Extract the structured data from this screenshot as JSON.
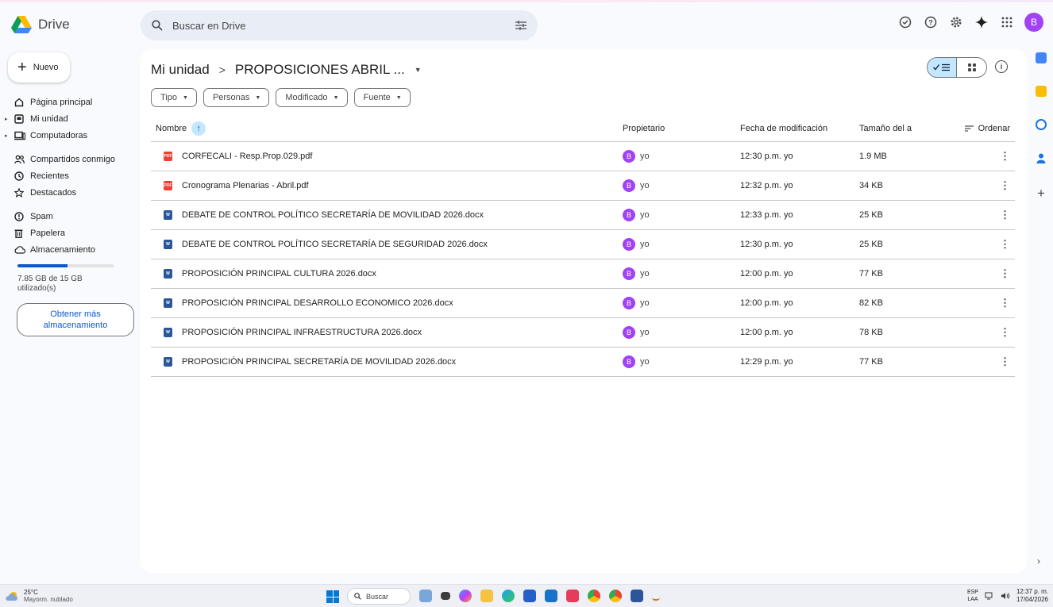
{
  "app": {
    "name": "Drive"
  },
  "search": {
    "placeholder": "Buscar en Drive"
  },
  "sidebar": {
    "new_label": "Nuevo",
    "items": [
      {
        "label": "Página principal"
      },
      {
        "label": "Mi unidad"
      },
      {
        "label": "Computadoras"
      },
      {
        "label": "Compartidos conmigo"
      },
      {
        "label": "Recientes"
      },
      {
        "label": "Destacados"
      },
      {
        "label": "Spam"
      },
      {
        "label": "Papelera"
      },
      {
        "label": "Almacenamiento"
      }
    ],
    "storage": {
      "used_text": "7.85 GB de 15 GB utilizado(s)",
      "fraction": 0.523,
      "more_label": "Obtener más almacenamiento"
    }
  },
  "breadcrumb": {
    "root": "Mi unidad",
    "separator": ">",
    "current": "PROPOSICIONES ABRIL ..."
  },
  "filters": [
    "Tipo",
    "Personas",
    "Modificado",
    "Fuente"
  ],
  "table": {
    "headers": {
      "name": "Nombre",
      "owner": "Propietario",
      "modified": "Fecha de modificación",
      "size": "Tamaño del a",
      "sort": "Ordenar"
    },
    "rows": [
      {
        "type": "pdf",
        "name": "CORFECALI - Resp.Prop.029.pdf",
        "owner_initial": "B",
        "owner": "yo",
        "modified": "12:30 p.m. yo",
        "size": "1.9 MB"
      },
      {
        "type": "pdf",
        "name": "Cronograma Plenarias - Abril.pdf",
        "owner_initial": "B",
        "owner": "yo",
        "modified": "12:32 p.m. yo",
        "size": "34 KB"
      },
      {
        "type": "word",
        "name": "DEBATE DE CONTROL POLÍTICO SECRETARÍA DE MOVILIDAD 2026.docx",
        "owner_initial": "B",
        "owner": "yo",
        "modified": "12:33 p.m. yo",
        "size": "25 KB"
      },
      {
        "type": "word",
        "name": "DEBATE DE CONTROL POLÍTICO SECRETARÍA DE SEGURIDAD 2026.docx",
        "owner_initial": "B",
        "owner": "yo",
        "modified": "12:30 p.m. yo",
        "size": "25 KB"
      },
      {
        "type": "word",
        "name": "PROPOSICIÓN PRINCIPAL CULTURA 2026.docx",
        "owner_initial": "B",
        "owner": "yo",
        "modified": "12:00 p.m. yo",
        "size": "77 KB"
      },
      {
        "type": "word",
        "name": "PROPOSICIÓN PRINCIPAL DESARROLLO ECONOMICO 2026.docx",
        "owner_initial": "B",
        "owner": "yo",
        "modified": "12:00 p.m. yo",
        "size": "82 KB"
      },
      {
        "type": "word",
        "name": "PROPOSICIÓN PRINCIPAL INFRAESTRUCTURA 2026.docx",
        "owner_initial": "B",
        "owner": "yo",
        "modified": "12:00 p.m. yo",
        "size": "78 KB"
      },
      {
        "type": "word",
        "name": "PROPOSICIÓN PRINCIPAL SECRETARÍA DE MOVILIDAD 2026.docx",
        "owner_initial": "B",
        "owner": "yo",
        "modified": "12:29 p.m. yo",
        "size": "77 KB"
      }
    ]
  },
  "account": {
    "initial": "B"
  },
  "taskbar": {
    "temp": "25°C",
    "weather": "Mayorm. nublado",
    "search": "Buscar",
    "lang1": "ESP",
    "lang2": "LAA",
    "time": "12:37 p. m.",
    "date": "17/04/2026"
  },
  "colors": {
    "accent": "#0b57d0",
    "selected": "#c2e7ff",
    "avatar": "#a142f4"
  }
}
